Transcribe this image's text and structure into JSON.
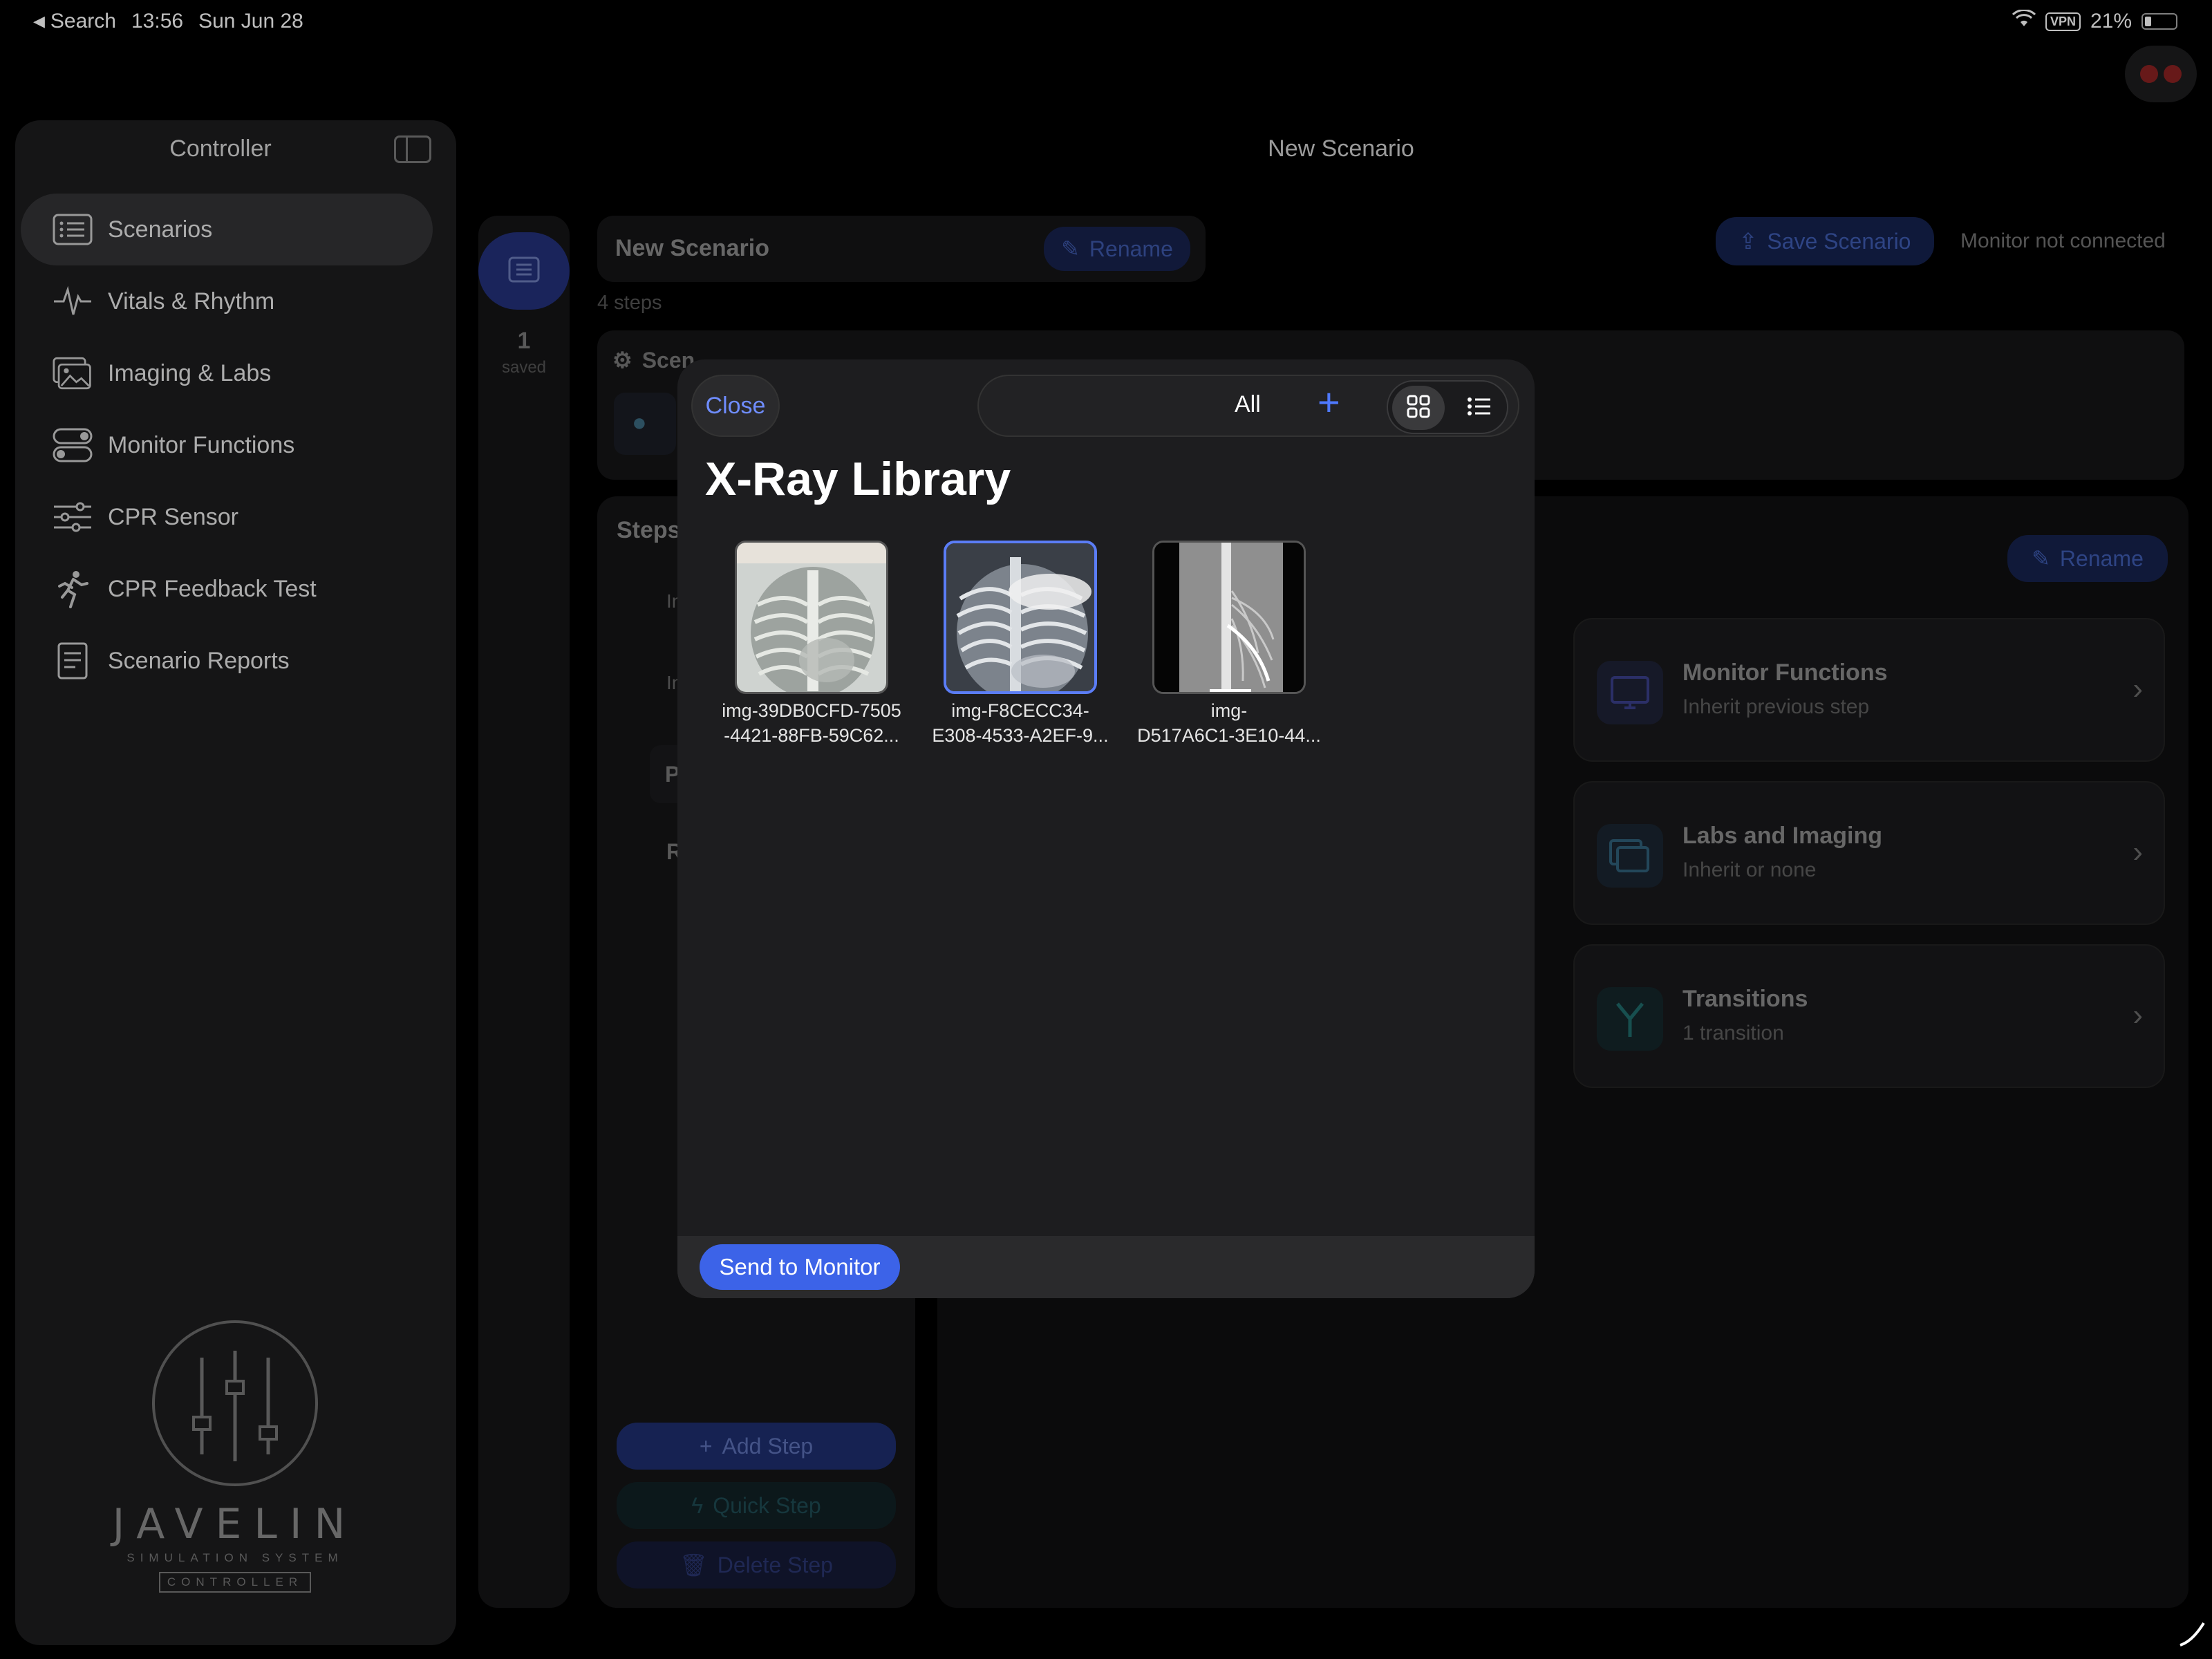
{
  "status_bar": {
    "back_label": "Search",
    "time": "13:56",
    "date": "Sun Jun 28",
    "vpn": "VPN",
    "battery": "21%"
  },
  "sidebar": {
    "title": "Controller",
    "items": [
      {
        "label": "Scenarios",
        "icon": "list-icon",
        "active": true
      },
      {
        "label": "Vitals & Rhythm",
        "icon": "waveform-icon"
      },
      {
        "label": "Imaging & Labs",
        "icon": "photos-icon"
      },
      {
        "label": "Monitor Functions",
        "icon": "toggles-icon"
      },
      {
        "label": "CPR Sensor",
        "icon": "sliders-icon"
      },
      {
        "label": "CPR Feedback Test",
        "icon": "running-figure-icon"
      },
      {
        "label": "Scenario Reports",
        "icon": "document-icon"
      }
    ],
    "logo": {
      "word": "JAVELIN",
      "subtitle": "SIMULATION SYSTEM",
      "tag": "CONTROLLER"
    }
  },
  "main": {
    "title": "New Scenario",
    "saved_count": "1",
    "saved_label": "saved",
    "scenario_name": "New Scenario",
    "rename_label": "Rename",
    "steps_count": "4 steps",
    "save_label": "Save Scenario",
    "monitor_status": "Monitor not connected",
    "scenario_section": "Scen",
    "steps_heading": "Steps",
    "step_initials": [
      "In",
      "In",
      "P",
      "R"
    ],
    "detail_rename": "Rename",
    "cards": [
      {
        "title": "Monitor Functions",
        "subtitle": "Inherit previous step",
        "icon": "monitor-icon"
      },
      {
        "title": "Labs and Imaging",
        "subtitle": "Inherit or none",
        "icon": "photos-icon"
      },
      {
        "title": "Transitions",
        "subtitle": "1 transition",
        "icon": "branch-icon"
      }
    ],
    "add_step": "Add Step",
    "quick_step": "Quick Step",
    "delete_step": "Delete Step"
  },
  "modal": {
    "close_label": "Close",
    "filter_label": "All",
    "title": "X-Ray Library",
    "images": [
      {
        "caption": "img-39DB0CFD-7505\n-4421-88FB-59C62...",
        "selected": false
      },
      {
        "caption": "img-F8CECC34-\nE308-4533-A2EF-9...",
        "selected": true
      },
      {
        "caption": "img-\nD517A6C1-3E10-44...",
        "selected": false
      }
    ],
    "send_label": "Send to Monitor"
  },
  "colors": {
    "accent": "#4f79ff",
    "send_button": "#3c63e8",
    "panel": "#1d1d1f",
    "sidebar": "#1c1c1e"
  }
}
